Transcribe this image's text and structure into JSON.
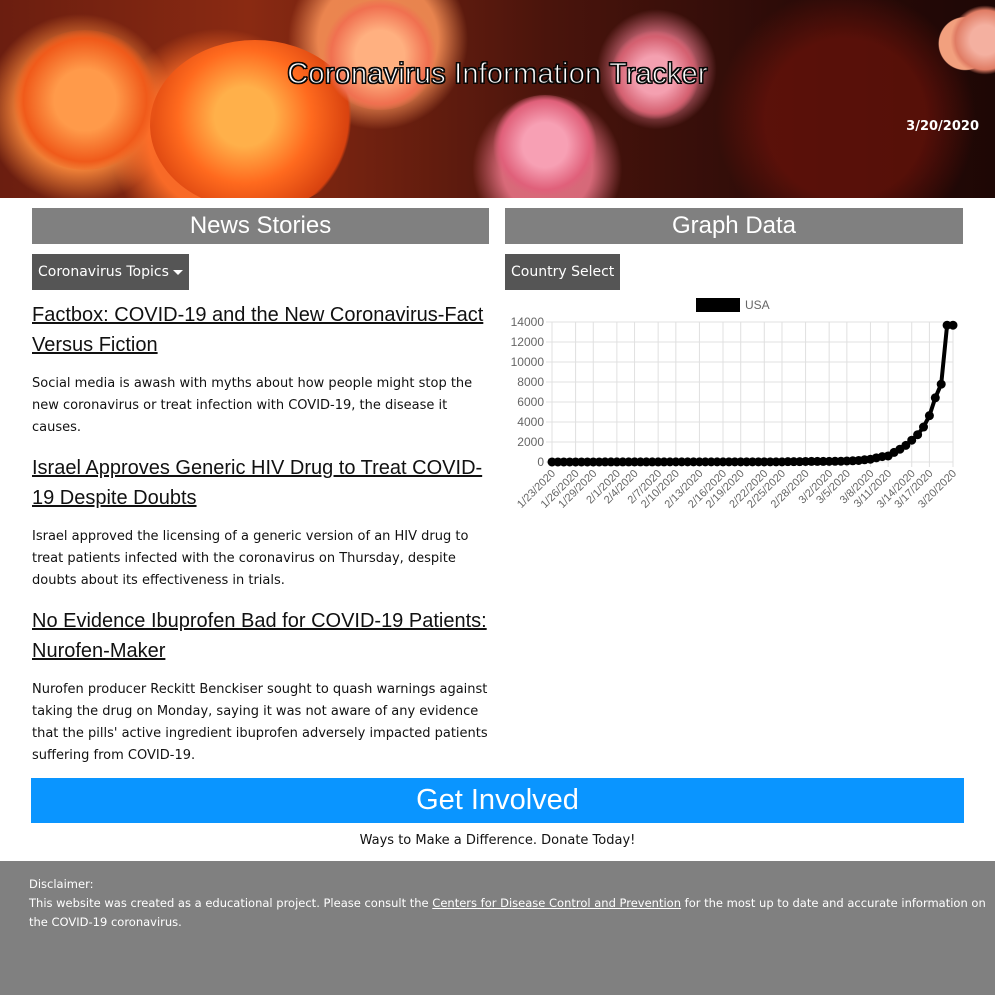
{
  "header": {
    "title": "Coronavirus Information Tracker",
    "date": "3/20/2020"
  },
  "news": {
    "heading": "News Stories",
    "dropdown_label": "Coronavirus Topics",
    "stories": [
      {
        "title": "Factbox: COVID-19 and the New Coronavirus-Fact Versus Fiction",
        "summary": "Social media is awash with myths about how people might stop the new coronavirus or treat infection with COVID-19, the disease it causes."
      },
      {
        "title": "Israel Approves Generic HIV Drug to Treat COVID-19 Despite Doubts",
        "summary": "Israel approved the licensing of a generic version of an HIV drug to treat patients infected with the coronavirus on Thursday, despite doubts about its effectiveness in trials."
      },
      {
        "title": "No Evidence Ibuprofen Bad for COVID-19 Patients: Nurofen-Maker",
        "summary": "Nurofen producer Reckitt Benckiser sought to quash warnings against taking the drug on Monday, saying it was not aware of any evidence that the pills' active ingredient ibuprofen adversely impacted patients suffering from COVID-19."
      }
    ]
  },
  "graph": {
    "heading": "Graph Data",
    "dropdown_label": "Country Select"
  },
  "chart_data": {
    "type": "line",
    "series": [
      {
        "name": "USA",
        "color": "#000000",
        "values": [
          1,
          1,
          2,
          2,
          5,
          5,
          5,
          5,
          5,
          7,
          8,
          8,
          11,
          11,
          11,
          11,
          11,
          11,
          11,
          11,
          12,
          12,
          13,
          13,
          13,
          13,
          13,
          13,
          13,
          13,
          15,
          15,
          15,
          15,
          15,
          15,
          15,
          15,
          15,
          15,
          35,
          35,
          35,
          53,
          57,
          60,
          60,
          62,
          70,
          76,
          101,
          122,
          153,
          221,
          278,
          417,
          537,
          605,
          959,
          1281,
          1663,
          2179,
          2726,
          3499,
          4632,
          6421,
          7786,
          13680,
          13680
        ]
      }
    ],
    "x_tick_labels": [
      "1/23/2020",
      "1/26/2020",
      "1/29/2020",
      "2/1/2020",
      "2/4/2020",
      "2/7/2020",
      "2/10/2020",
      "2/13/2020",
      "2/16/2020",
      "2/19/2020",
      "2/22/2020",
      "2/25/2020",
      "2/28/2020",
      "3/2/2020",
      "3/5/2020",
      "3/8/2020",
      "3/11/2020",
      "3/14/2020",
      "3/17/2020",
      "3/20/2020"
    ],
    "y_ticks": [
      0,
      2000,
      4000,
      6000,
      8000,
      10000,
      12000,
      14000
    ],
    "ylim": [
      0,
      14000
    ],
    "grid": true,
    "legend_position": "top"
  },
  "involve": {
    "title": "Get Involved",
    "subtitle": "Ways to Make a Difference. Donate Today!"
  },
  "footer": {
    "disclaimer_label": "Disclaimer:",
    "text_before_link": "This website was created as a educational project. Please consult the ",
    "link_text": "Centers for Disease Control and Prevention",
    "text_after_link": " for the most up to date and accurate information on the COVID-19 coronavirus."
  }
}
